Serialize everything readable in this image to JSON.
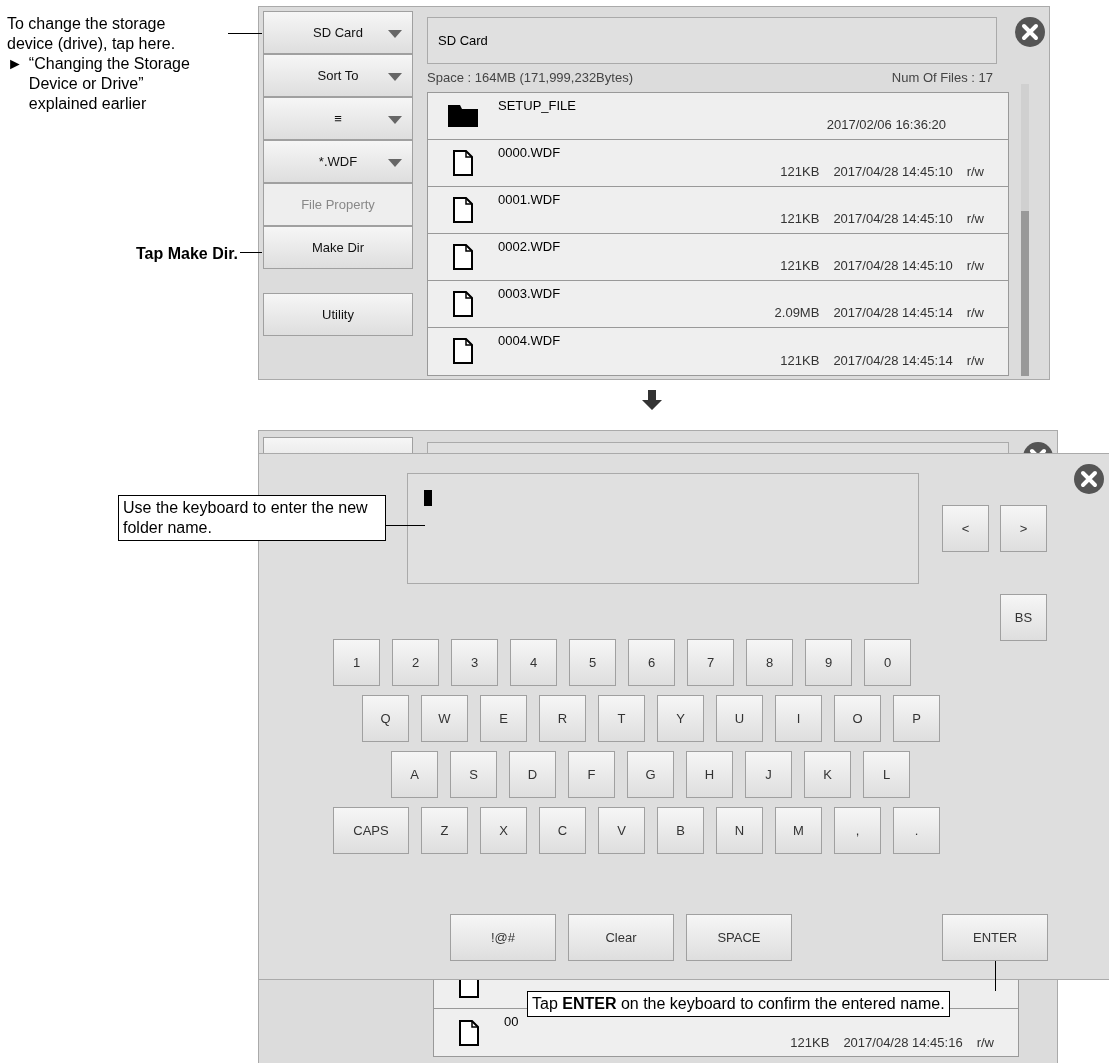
{
  "top_callouts": {
    "storage": "To change the storage device (drive), tap here.",
    "reference_mark": "►",
    "reference": "“Changing the Storage Device or Drive” explained earlier",
    "make_dir": "Tap Make Dir."
  },
  "file_screen": {
    "side_buttons": [
      {
        "label": "SD Card",
        "dropdown": true,
        "disabled": false
      },
      {
        "label": "Sort To",
        "dropdown": true,
        "disabled": false
      },
      {
        "label": "≡",
        "dropdown": true,
        "disabled": false
      },
      {
        "label": "*.WDF",
        "dropdown": true,
        "disabled": false
      },
      {
        "label": "File Property",
        "dropdown": false,
        "disabled": true
      },
      {
        "label": "Make Dir",
        "dropdown": false,
        "disabled": false
      }
    ],
    "utility_button": "Utility",
    "path": "SD Card",
    "space": "Space : 164MB (171,999,232Bytes)",
    "file_count": "Num Of Files : 17",
    "files": [
      {
        "kind": "folder",
        "name": "SETUP_FILE",
        "date": "2017/02/06 16:36:20"
      },
      {
        "kind": "file",
        "name": "0000.WDF",
        "size": "121KB",
        "date": "2017/04/28 14:45:10",
        "access": "r/w"
      },
      {
        "kind": "file",
        "name": "0001.WDF",
        "size": "121KB",
        "date": "2017/04/28 14:45:10",
        "access": "r/w"
      },
      {
        "kind": "file",
        "name": "0002.WDF",
        "size": "121KB",
        "date": "2017/04/28 14:45:10",
        "access": "r/w"
      },
      {
        "kind": "file",
        "name": "0003.WDF",
        "size": "2.09MB",
        "date": "2017/04/28 14:45:14",
        "access": "r/w"
      },
      {
        "kind": "file",
        "name": "0004.WDF",
        "size": "121KB",
        "date": "2017/04/28 14:45:14",
        "access": "r/w"
      }
    ]
  },
  "keyboard_screen": {
    "behind_files": [
      {
        "kind": "file"
      },
      {
        "kind": "file",
        "name": "00",
        "size": "121KB",
        "date": "2017/04/28 14:45:16",
        "access": "r/w"
      }
    ],
    "nav_keys": [
      "<",
      ">"
    ],
    "backspace": "BS",
    "key_rows": [
      [
        "1",
        "2",
        "3",
        "4",
        "5",
        "6",
        "7",
        "8",
        "9",
        "0"
      ],
      [
        "Q",
        "W",
        "E",
        "R",
        "T",
        "Y",
        "U",
        "I",
        "O",
        "P"
      ],
      [
        "A",
        "S",
        "D",
        "F",
        "G",
        "H",
        "J",
        "K",
        "L"
      ],
      [
        "CAPS",
        "Z",
        "X",
        "C",
        "V",
        "B",
        "N",
        "M",
        ",",
        "."
      ]
    ],
    "bottom_keys": [
      "!@#",
      "Clear",
      "SPACE"
    ],
    "enter": "ENTER"
  },
  "bottom_callouts": {
    "keyboard": "Use the keyboard to enter the new folder name.",
    "enter": "Tap **ENTER** on the keyboard to confirm the entered name."
  }
}
